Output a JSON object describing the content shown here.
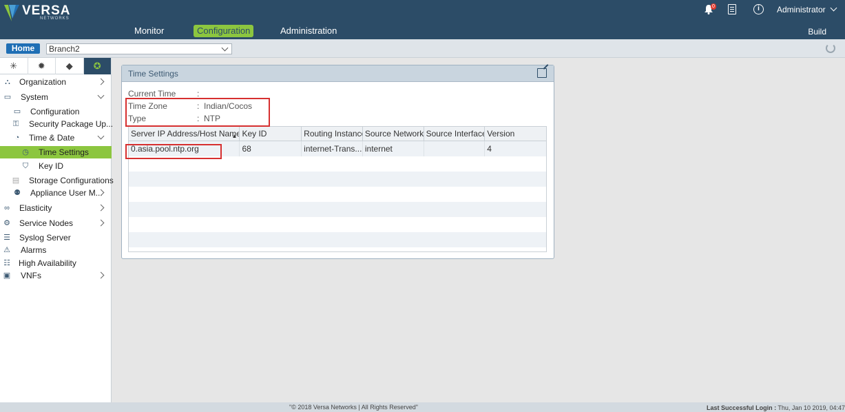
{
  "brand": {
    "name": "VERSA",
    "sub": "NETWORKS"
  },
  "nav": {
    "monitor": "Monitor",
    "configuration": "Configuration",
    "administration": "Administration",
    "build": "Build"
  },
  "header": {
    "notification_count": "0",
    "user": "Administrator",
    "info_glyph": "i"
  },
  "subbar": {
    "home": "Home",
    "appliance": "Branch2"
  },
  "sidebar": {
    "tabs": [
      {
        "icon": "network-icon",
        "glyph": "✳"
      },
      {
        "icon": "gear-icon",
        "glyph": "✹"
      },
      {
        "icon": "cube-icon",
        "glyph": "◆"
      },
      {
        "icon": "globe-gear-icon",
        "glyph": "✪"
      }
    ],
    "items": [
      {
        "label": "Organization"
      },
      {
        "label": "System"
      },
      {
        "label": "Configuration"
      },
      {
        "label": "Security Package Up..."
      },
      {
        "label": "Time & Date"
      },
      {
        "label": "Time Settings"
      },
      {
        "label": "Key ID"
      },
      {
        "label": "Storage Configurations"
      },
      {
        "label": "Appliance User M..."
      },
      {
        "label": "Elasticity"
      },
      {
        "label": "Service Nodes"
      },
      {
        "label": "Syslog Server"
      },
      {
        "label": "Alarms"
      },
      {
        "label": "High Availability"
      },
      {
        "label": "VNFs"
      }
    ]
  },
  "panel": {
    "title": "Time Settings",
    "current_time_label": "Current Time",
    "current_time_value": "",
    "time_zone_label": "Time Zone",
    "time_zone_value": "Indian/Cocos",
    "type_label": "Type",
    "type_value": "NTP",
    "separator": ":"
  },
  "table": {
    "columns": [
      "Server IP Address/Host Name",
      "Key ID",
      "Routing Instance",
      "Source Network",
      "Source Interface",
      "Version"
    ],
    "rows": [
      [
        "0.asia.pool.ntp.org",
        "68",
        "internet-Trans...",
        "internet",
        "",
        "4"
      ]
    ]
  },
  "footer": {
    "copyright": "\"© 2018 Versa Networks | All Rights Reserved\"",
    "last_login_label": "Last Successful Login :",
    "last_login_value": "Thu, Jan 10 2019, 04:47"
  },
  "colors": {
    "topbar": "#2c4c67",
    "accent": "#8cc63f",
    "home": "#1f6fb5",
    "highlight": "#d62f2f"
  }
}
